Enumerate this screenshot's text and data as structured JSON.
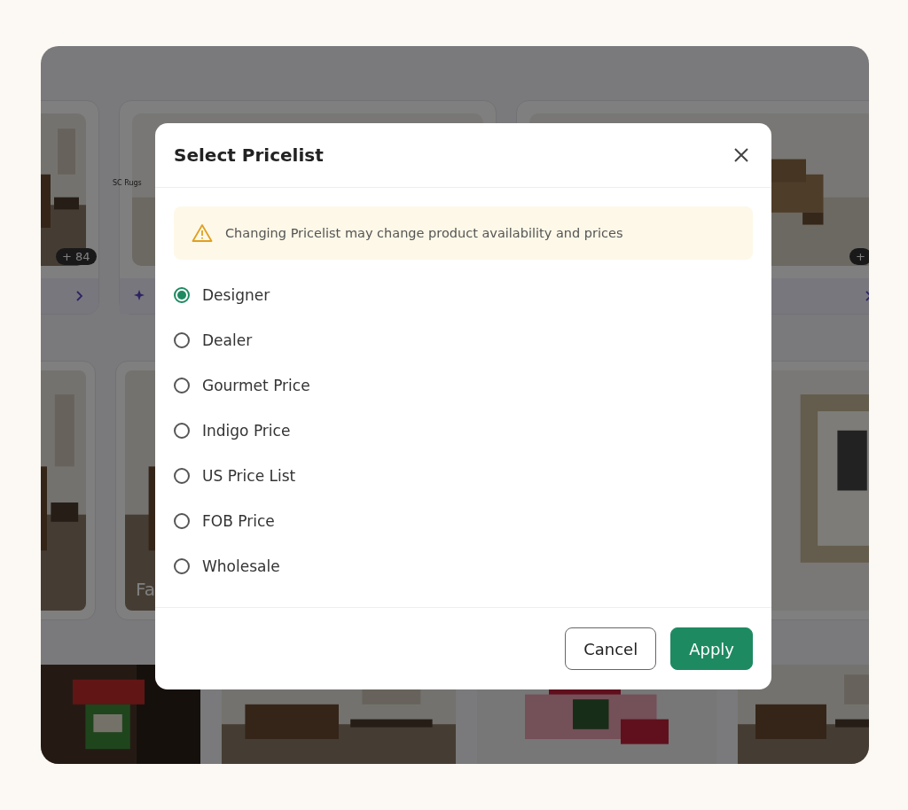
{
  "background": {
    "top_cards": [
      {
        "badge": "+ 84"
      },
      {
        "caption": "SC Rugs"
      },
      {
        "badge": "+"
      }
    ],
    "middle_cards": [
      {
        "title": "Fa"
      }
    ]
  },
  "dialog": {
    "title": "Select Pricelist",
    "notice": "Changing Pricelist may change product availability and prices",
    "options": [
      {
        "label": "Designer",
        "selected": true
      },
      {
        "label": "Dealer",
        "selected": false
      },
      {
        "label": "Gourmet Price",
        "selected": false
      },
      {
        "label": "Indigo Price",
        "selected": false
      },
      {
        "label": "US Price List",
        "selected": false
      },
      {
        "label": "FOB Price",
        "selected": false
      },
      {
        "label": "Wholesale",
        "selected": false
      }
    ],
    "buttons": [
      {
        "label": "Cancel",
        "kind": "secondary"
      },
      {
        "label": "Apply",
        "kind": "primary"
      }
    ]
  }
}
